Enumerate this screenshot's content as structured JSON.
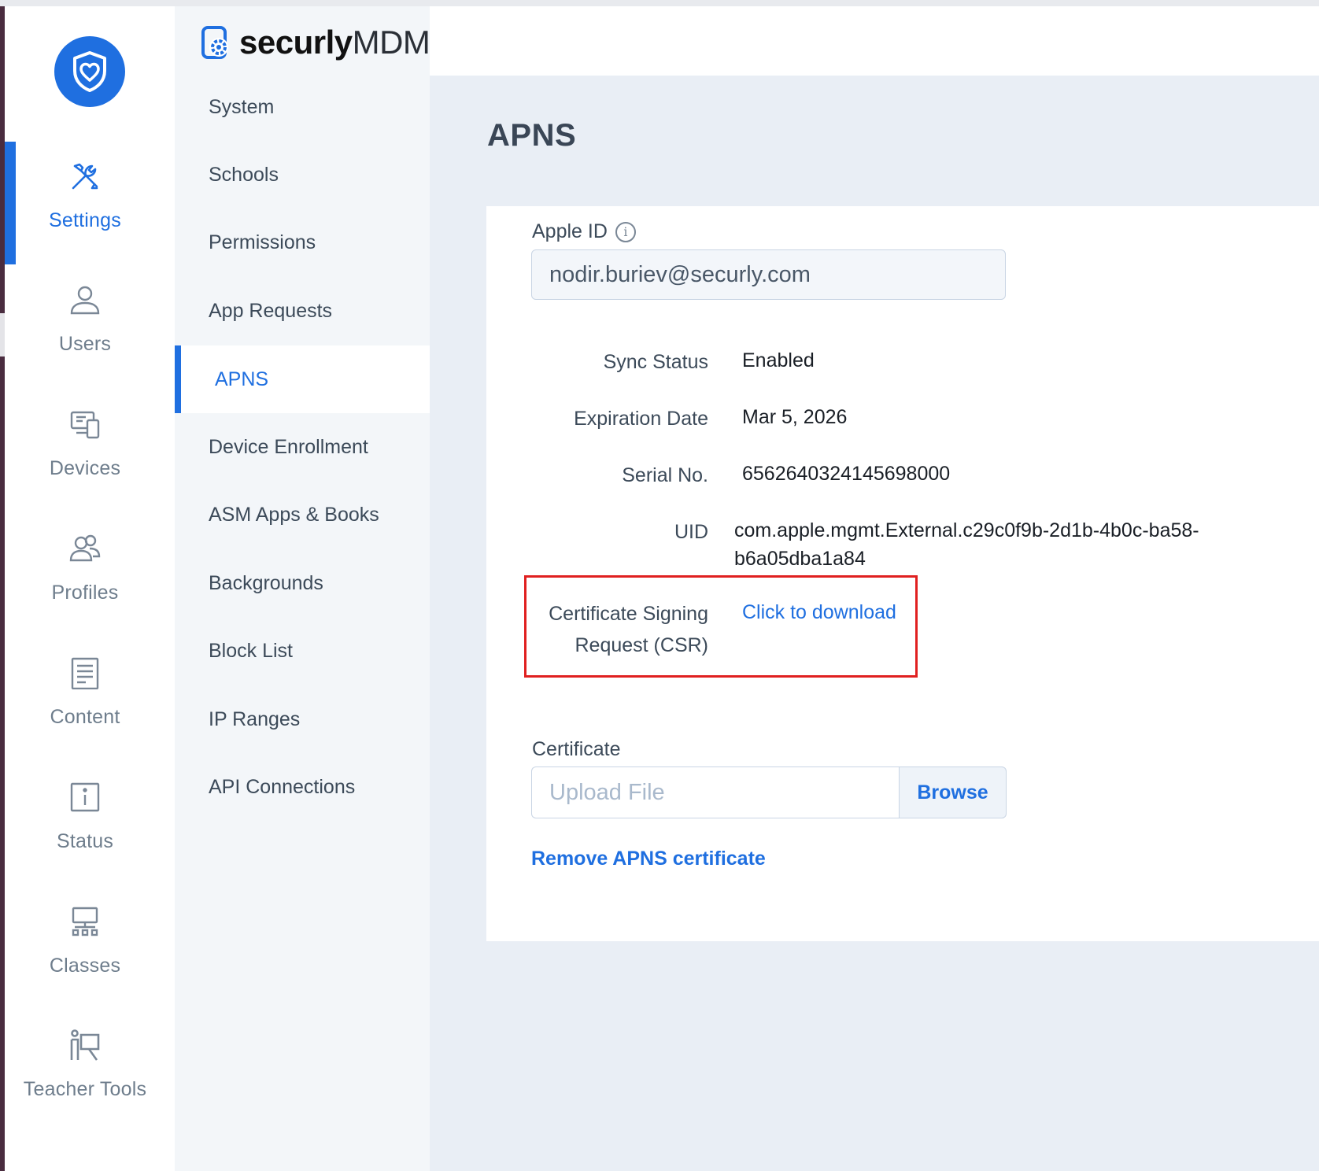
{
  "brand": {
    "name_bold": "securly",
    "name_light": "MDM"
  },
  "rail": {
    "items": [
      {
        "label": "Settings",
        "icon": "tools-icon",
        "active": true
      },
      {
        "label": "Users",
        "icon": "user-icon"
      },
      {
        "label": "Devices",
        "icon": "devices-icon"
      },
      {
        "label": "Profiles",
        "icon": "profiles-icon"
      },
      {
        "label": "Content",
        "icon": "document-icon"
      },
      {
        "label": "Status",
        "icon": "info-square-icon"
      },
      {
        "label": "Classes",
        "icon": "classroom-icon"
      },
      {
        "label": "Teacher Tools",
        "icon": "teacher-icon"
      }
    ]
  },
  "subnav": {
    "items": [
      {
        "label": "System"
      },
      {
        "label": "Schools"
      },
      {
        "label": "Permissions"
      },
      {
        "label": "App Requests"
      },
      {
        "label": "APNS",
        "active": true
      },
      {
        "label": "Device Enrollment"
      },
      {
        "label": "ASM Apps & Books"
      },
      {
        "label": "Backgrounds"
      },
      {
        "label": "Block List"
      },
      {
        "label": "IP Ranges"
      },
      {
        "label": "API Connections"
      }
    ]
  },
  "page": {
    "title": "APNS",
    "apple_id": {
      "label": "Apple ID",
      "value": "nodir.buriev@securly.com"
    },
    "fields": {
      "sync_status": {
        "label": "Sync Status",
        "value": "Enabled"
      },
      "expiration_date": {
        "label": "Expiration Date",
        "value": "Mar 5, 2026"
      },
      "serial_no": {
        "label": "Serial No.",
        "value": "6562640324145698000"
      },
      "uid": {
        "label": "UID",
        "value_line1": "com.apple.mgmt.External.c29c0f9b-2d1b-4b0c-ba58-",
        "value_line2": "b6a05dba1a84"
      },
      "csr": {
        "label_line1": "Certificate Signing",
        "label_line2": "Request (CSR)",
        "link": "Click to download"
      }
    },
    "certificate": {
      "label": "Certificate",
      "placeholder": "Upload File",
      "browse": "Browse"
    },
    "remove_link": "Remove APNS certificate"
  },
  "colors": {
    "accent": "#1f6fe0",
    "highlight": "#e02020",
    "main_bg": "#e9eef5",
    "subnav_bg": "#f3f6f9"
  }
}
